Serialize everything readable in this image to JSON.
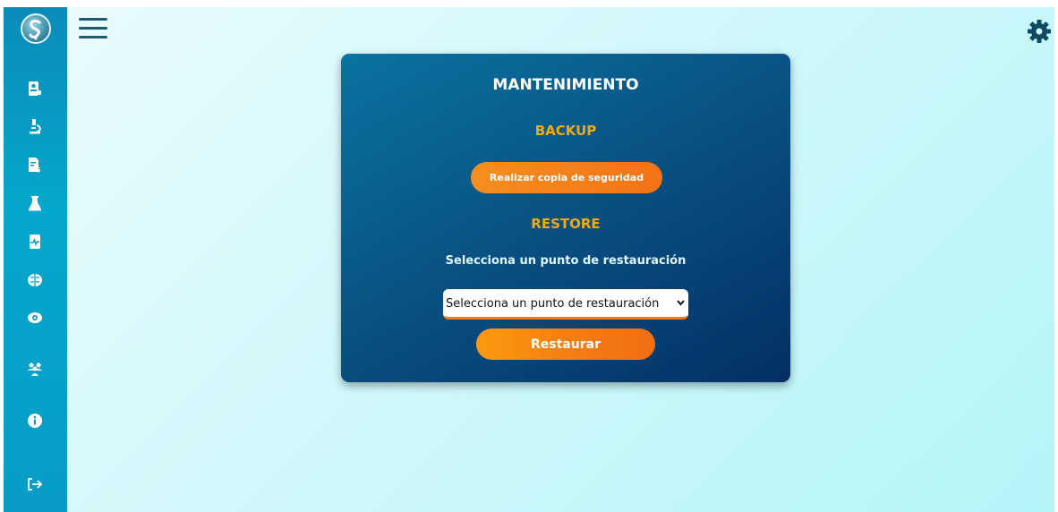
{
  "sidebar": {
    "logo": "app-logo",
    "items": [
      {
        "icon": "patient-id-icon"
      },
      {
        "icon": "microscope-icon"
      },
      {
        "icon": "invoice-icon"
      },
      {
        "icon": "flask-icon"
      },
      {
        "icon": "medical-file-icon"
      },
      {
        "icon": "brain-icon"
      },
      {
        "icon": "eye-icon"
      },
      {
        "icon": "users-icon"
      },
      {
        "icon": "info-icon"
      },
      {
        "icon": "logout-icon"
      }
    ]
  },
  "header": {
    "menu_icon": "hamburger-menu-icon",
    "settings_icon": "gear-icon"
  },
  "card": {
    "title": "MANTENIMIENTO",
    "backup": {
      "title": "BACKUP",
      "button_label": "Realizar copia de seguridad"
    },
    "restore": {
      "title": "RESTORE",
      "label": "Selecciona un punto de restauración",
      "select_value": "Selecciona un punto de restauración",
      "button_label": "Restaurar"
    }
  },
  "colors": {
    "sidebar": "#089cc6",
    "card_start": "#0a73a1",
    "card_end": "#042f66",
    "accent_orange": "#f57a1a",
    "section_title": "#f6a90b"
  }
}
